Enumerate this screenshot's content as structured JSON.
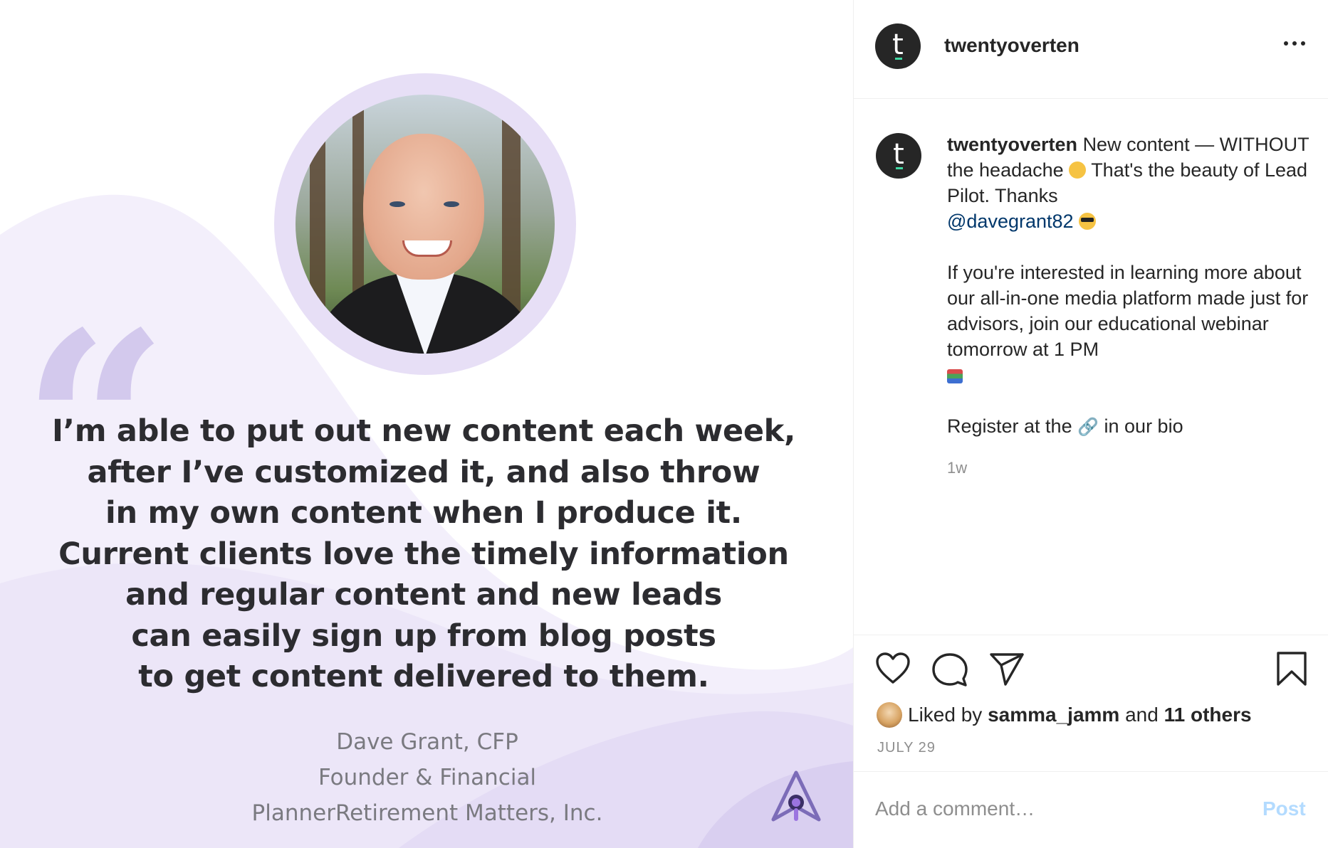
{
  "header": {
    "username": "twentyoverten",
    "avatar_letter": "t",
    "more_icon": "ellipsis-icon"
  },
  "media": {
    "quote_mark": "“",
    "quote": "I’m able to put out new content each week,\nafter I’ve customized it, and also throw\nin my own content when I produce it.\nCurrent clients love the timely information\nand regular content and new leads\ncan easily sign up from blog posts\nto get content delivered to them.",
    "attribution": [
      "Dave Grant, CFP",
      "Founder & Financial",
      "PlannerRetirement Matters, Inc."
    ],
    "accent_color": "#c9bde9",
    "logo_icon": "lead-pilot-logo"
  },
  "caption": {
    "username": "twentyoverten",
    "text_1": "New content — WITHOUT the headache",
    "text_2": "That's the beauty of Lead Pilot. Thanks",
    "mention": "@davegrant82",
    "text_3": "If you're interested in learning more about our all-in-one media platform made just for advisors, join our educational webinar tomorrow at 1 PM",
    "text_4a": "Register at the",
    "link_emoji": "🔗",
    "text_4b": "in our bio",
    "time": "1w"
  },
  "actions": {
    "like_icon": "heart-icon",
    "comment_icon": "comment-icon",
    "share_icon": "send-icon",
    "save_icon": "bookmark-icon",
    "liked_by_prefix": "Liked by",
    "liked_by_user": "samma_jamm",
    "liked_by_and": "and",
    "liked_by_others": "11 others",
    "date": "JULY 29"
  },
  "comment": {
    "placeholder": "Add a comment…",
    "post_label": "Post",
    "post_color": "#b3dbff"
  }
}
